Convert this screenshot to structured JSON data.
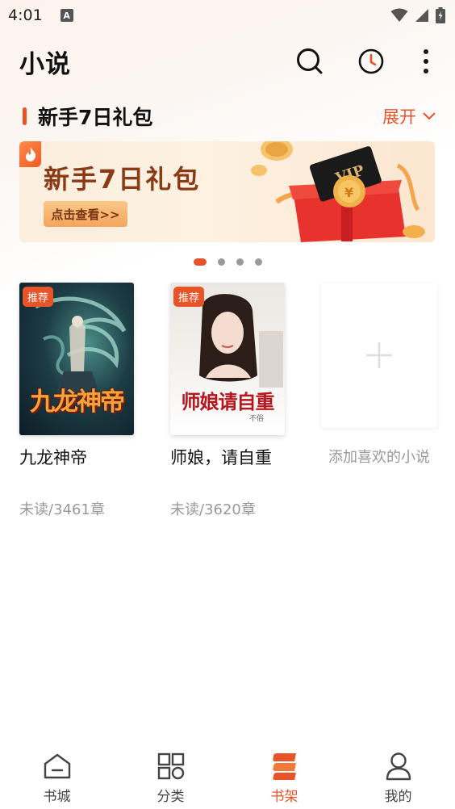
{
  "status_bar": {
    "time": "4:01",
    "notification_letter": "A"
  },
  "header": {
    "title": "小说"
  },
  "section": {
    "title": "新手7日礼包",
    "expand_label": "展开"
  },
  "banner": {
    "title": "新手7日礼包",
    "cta": "点击查看>>",
    "card_text": "VIP"
  },
  "carousel": {
    "total": 4,
    "active_index": 0
  },
  "books": [
    {
      "badge": "推荐",
      "cover_title": "九龙神帝",
      "name": "九龙神帝",
      "progress": "未读/3461章"
    },
    {
      "badge": "推荐",
      "cover_title": "师娘请自重",
      "cover_author": "不俗",
      "name": "师娘，请自重",
      "progress": "未读/3620章"
    }
  ],
  "add_book": {
    "label": "添加喜欢的小说"
  },
  "bottom_nav": [
    {
      "label": "书城",
      "icon": "home-icon",
      "active": false
    },
    {
      "label": "分类",
      "icon": "category-icon",
      "active": false
    },
    {
      "label": "书架",
      "icon": "bookshelf-icon",
      "active": true
    },
    {
      "label": "我的",
      "icon": "profile-icon",
      "active": false
    }
  ],
  "colors": {
    "accent": "#e8542a",
    "text_primary": "#111111",
    "text_secondary": "#999999"
  }
}
